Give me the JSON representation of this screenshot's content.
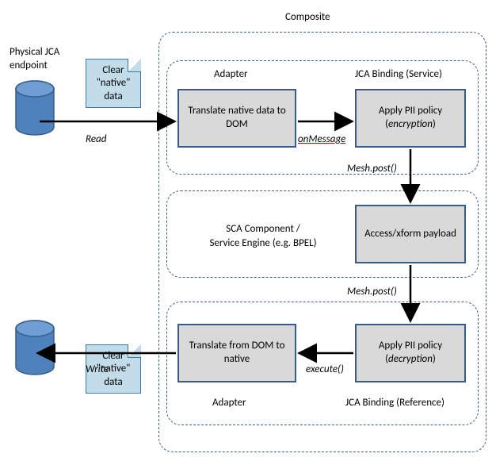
{
  "title": "Composite",
  "labels": {
    "physical_endpoint": "Physical JCA endpoint",
    "composite": "Composite",
    "adapter_top": "Adapter",
    "jca_service": "JCA Binding (Service)",
    "adapter_bottom": "Adapter",
    "jca_reference": "JCA Binding (Reference)",
    "sca_component": "SCA Component / Service Engine (e.g. BPEL)",
    "read": "Read",
    "write": "Write",
    "on_message": "onMessage",
    "mesh_post_1": "Mesh.post()",
    "mesh_post_2": "Mesh.post()",
    "execute": "execute()"
  },
  "notes": {
    "clear_native_data": "Clear \"native\" data"
  },
  "processes": {
    "translate_to_dom": "Translate native data to DOM",
    "apply_encrypt": "Apply PII policy (encryption)",
    "access_payload": "Access/xform payload",
    "apply_decrypt": "Apply PII policy (decryption)",
    "translate_to_native": "Translate from DOM to native"
  }
}
